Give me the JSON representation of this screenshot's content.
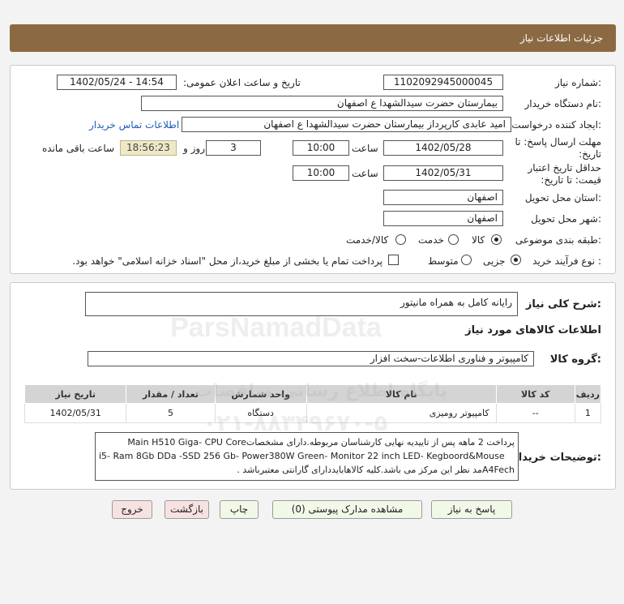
{
  "header": {
    "title": "جزئیات اطلاعات نیاز"
  },
  "form": {
    "need_number_label": "شماره نیاز:",
    "need_number": "1102092945000045",
    "announce_label": "تاریخ و ساعت اعلان عمومی:",
    "announce_value": "1402/05/24 - 14:54",
    "buyer_org_label": "نام دستگاه خریدار:",
    "buyer_org": "بیمارستان حضرت سیدالشهدا ع  اصفهان",
    "creator_label": "ایجاد کننده درخواست:",
    "creator": "امید  عابدی  کارپرداز  بیمارستان حضرت سیدالشهدا ع  اصفهان",
    "contact_link": "اطلاعات تماس خریدار",
    "reply_deadline_label": "مهلت ارسال پاسخ: تا تاریخ:",
    "reply_date": "1402/05/28",
    "time_label": "ساعت",
    "reply_time": "10:00",
    "days_value": "3",
    "days_label": "روز و",
    "remaining_time": "18:56:23",
    "remaining_label": "ساعت باقی مانده",
    "validity_label": "حداقل تاریخ اعتبار قیمت: تا تاریخ:",
    "validity_date": "1402/05/31",
    "validity_time": "10:00",
    "province_label": "استان محل تحویل:",
    "province": "اصفهان",
    "city_label": "شهر محل تحویل:",
    "city": "اصفهان",
    "category_label": "طبقه بندی موضوعی:",
    "category_options": [
      "کالا",
      "خدمت",
      "کالا/خدمت"
    ],
    "process_label": "نوع فرآیند خرید :",
    "process_options": [
      "جزیی",
      "متوسط"
    ],
    "payment_note": "پرداخت تمام یا بخشی از مبلغ خرید،از محل \"اسناد خزانه اسلامی\" خواهد بود."
  },
  "summary": {
    "label": "شرح کلی نیاز:",
    "value": "رایانه کامل به همراه مانیتور",
    "goods_info_title": "اطلاعات کالاهای مورد نیاز",
    "group_label": "گروه کالا:",
    "group_value": "کامپیوتر و فناوری اطلاعات-سخت افزار"
  },
  "table": {
    "headers": [
      "ردیف",
      "کد کالا",
      "نام کالا",
      "واحد شمارش",
      "تعداد / مقدار",
      "تاریخ نیاز"
    ],
    "rows": [
      [
        "1",
        "--",
        "کامپیوتر رومیزی",
        "دستگاه",
        "5",
        "1402/05/31"
      ]
    ]
  },
  "buyer_notes": {
    "label": "توضیحات خریدار:",
    "line1": "پرداخت 2 ماهه پس از تاییدیه نهایی کارشناسان مربوطه.دارای مشخصاتMain H510 Giga- CPU Core",
    "line2": "i5- Ram 8Gb DDa     -SSD 256 Gb- Power380W Green- Monitor 22 inch LED- Kegboord&Mouse",
    "line3": "A4Fechمد نظر این مرکز می باشد.کلیه کالاهابایددارای گارانتی معتبرباشد ."
  },
  "buttons": {
    "reply": "پاسخ به نیاز",
    "attachments": "مشاهده مدارک پیوستی (0)",
    "print": "چاپ",
    "back": "بازگشت",
    "exit": "خروج"
  },
  "watermark": {
    "line1": "ParsNamadData",
    "line2": "پایگاه اطلاع رسانی مناقصات",
    "line3": "۰۲۱-۸۸۳۴۹۶۷۰-۵"
  }
}
